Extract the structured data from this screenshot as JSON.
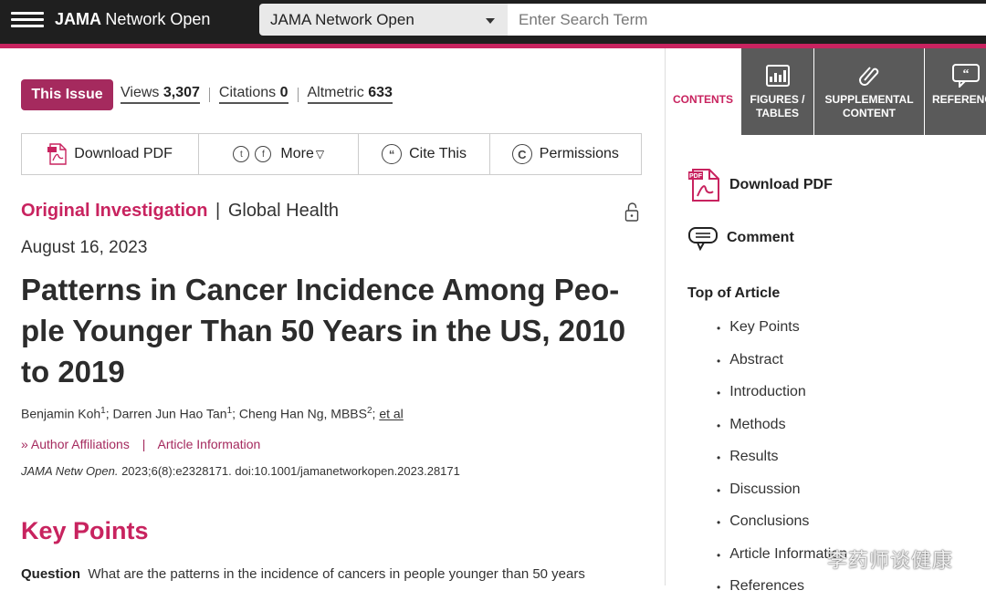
{
  "header": {
    "brand_bold": "JAMA",
    "brand_light": "Network Open",
    "site_select": "JAMA Network Open",
    "search_placeholder": "Enter Search Term"
  },
  "issue": {
    "this_issue": "This Issue",
    "views_label": "Views",
    "views_value": "3,307",
    "citations_label": "Citations",
    "citations_value": "0",
    "altmetric_label": "Altmetric",
    "altmetric_value": "633"
  },
  "toolbar": {
    "download_pdf": "Download PDF",
    "more": "More",
    "cite_this": "Cite This",
    "permissions": "Permissions"
  },
  "article": {
    "category_main": "Original Investigation",
    "category_sep": "|",
    "category_sub": "Global Health",
    "date": "August 16, 2023",
    "title": "Patterns in Cancer Incidence Among Peo-ple Younger Than 50 Years in the US, 2010 to 2019",
    "authors": {
      "a1": "Benjamin Koh",
      "a1_sup": "1",
      "a2": "; Darren Jun Hao Tan",
      "a2_sup": "1",
      "a3": "; Cheng Han Ng, MBBS",
      "a3_sup": "2",
      "a3_after": ";",
      "et_al": "et al"
    },
    "author_affiliations": "Author Affiliations",
    "links_sep": "|",
    "article_information": "Article Information",
    "citation_journal": "JAMA Netw Open.",
    "citation_rest": " 2023;6(8):e2328171. doi:10.1001/jamanetworkopen.2023.28171",
    "key_points_heading": "Key Points",
    "question_label": "Question",
    "question_text": "What are the patterns in the incidence of cancers in people younger than 50 years"
  },
  "sidebar": {
    "tabs": [
      {
        "label_line1": "CONTENTS",
        "label_line2": ""
      },
      {
        "label_line1": "FIGURES /",
        "label_line2": "TABLES"
      },
      {
        "label_line1": "SUPPLEMENTAL",
        "label_line2": "CONTENT"
      },
      {
        "label_line1": "REFERENCES",
        "label_line2": ""
      }
    ],
    "download_pdf": "Download PDF",
    "comment": "Comment",
    "toc_heading": "Top of Article",
    "toc": [
      "Key Points",
      "Abstract",
      "Introduction",
      "Methods",
      "Results",
      "Discussion",
      "Conclusions",
      "Article Information",
      "References"
    ]
  },
  "watermark": "李药师谈健康",
  "colors": {
    "accent": "#c8235f",
    "this_issue_bg": "#a52a5e",
    "header_bg": "#1f1f1f",
    "tab_dark": "#5a5a5a"
  }
}
